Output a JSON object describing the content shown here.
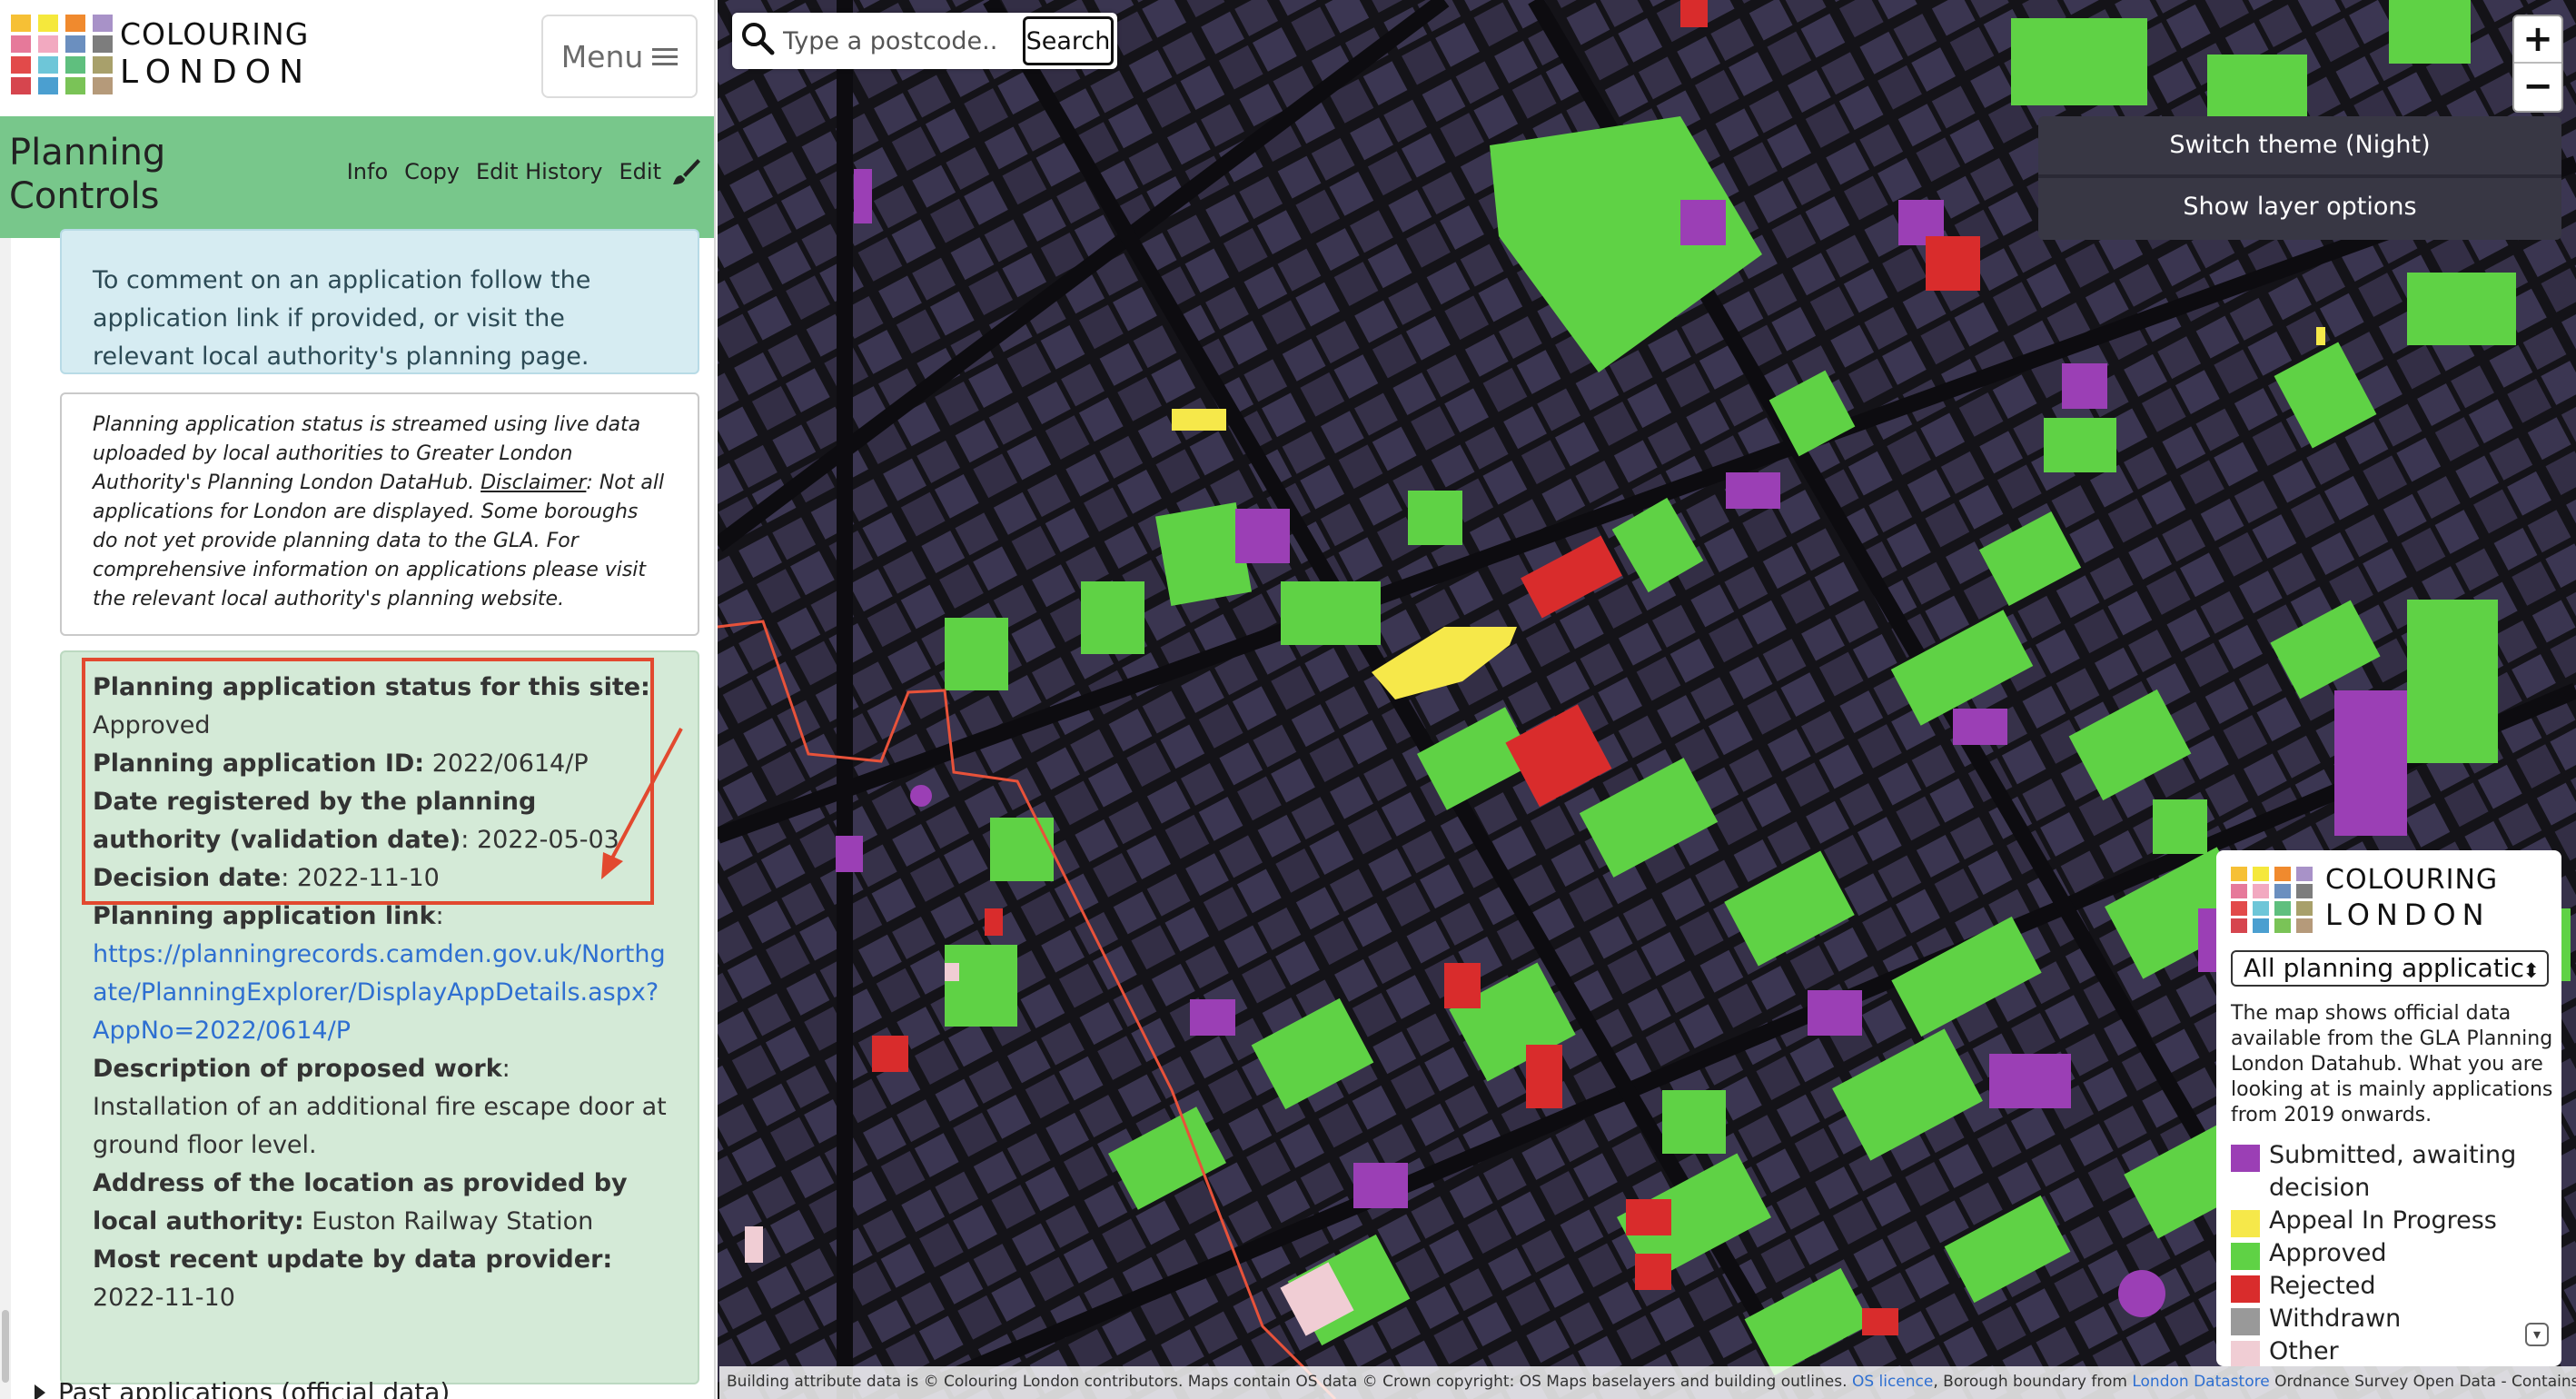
{
  "app": {
    "logo_line1": "COLOURING",
    "logo_line2": "LONDON",
    "menu_label": "Menu"
  },
  "section": {
    "title": "Planning Controls",
    "links": [
      "Info",
      "Copy",
      "Edit History",
      "Edit"
    ]
  },
  "info_panel": {
    "text": "To comment on an application follow the application link if provided, or visit the relevant local authority's planning page."
  },
  "disclaimer_panel": {
    "text1": "Planning application status is streamed using live data uploaded by local authorities to Greater London Authority's Planning London DataHub.",
    "disclaimer_label": "Disclaimer",
    "text2": ": Not all applications for London are displayed. Some boroughs do not yet provide planning data to the GLA. For comprehensive information on applications please visit the relevant local authority's planning website."
  },
  "status_panel": {
    "status_label": "Planning application status for this site:",
    "status_value": "Approved",
    "id_label": "Planning application ID:",
    "id_value": "2022/0614/P",
    "date_label": "Date registered by the planning authority (validation date)",
    "date_value": ": 2022-05-03",
    "decision_label": "Decision date",
    "decision_value": ": 2022-11-10",
    "link_label": "Planning application link",
    "link_colon": ":",
    "link_value": "https://planningrecords.camden.gov.uk/Northgate/PlanningExplorer/DisplayAppDetails.aspx?AppNo=2022/0614/P",
    "description_label": "Description of proposed work",
    "description_colon": ":",
    "description_value": "Installation of an additional fire escape door at ground floor level.",
    "address_label": "Address of the location as provided by local authority:",
    "address_value": "Euston Railway Station",
    "update_label": "Most recent update by data provider:",
    "update_value": "2022-11-10"
  },
  "past_apps": {
    "label": "Past applications (official data)"
  },
  "search": {
    "placeholder": "Type a postcode..",
    "button_label": "Search"
  },
  "zoom": {
    "in_label": "+",
    "out_label": "−"
  },
  "map_controls": {
    "theme_label": "Switch theme (Night)",
    "layer_label": "Show layer options"
  },
  "legend": {
    "logo_line1": "COLOURING",
    "logo_line2": "LONDON",
    "select_value": "All planning applicatic",
    "description": "The map shows official data available from the GLA Planning London Datahub. What you are looking at is mainly applications from 2019 onwards.",
    "items": [
      {
        "label": "Submitted, awaiting decision",
        "color": "#9b3fb5"
      },
      {
        "label": "Appeal In Progress",
        "color": "#f6e84a"
      },
      {
        "label": "Approved",
        "color": "#5fd245"
      },
      {
        "label": "Rejected",
        "color": "#d92c2c"
      },
      {
        "label": "Withdrawn",
        "color": "#999999"
      },
      {
        "label": "Other",
        "color": "#f0cdd4"
      }
    ]
  },
  "attribution": {
    "text1": "Building attribute data is © Colouring London contributors. Maps contain OS data © Crown copyright: OS Maps baselayers and building outlines. ",
    "os_licence": "OS licence",
    "text2": ", Borough boundary from ",
    "datastore": "London Datastore",
    "text3": " Ordnance Survey Open Data - Contains public"
  },
  "colors": {
    "section_header": "#78c78b",
    "map_background": "#2b2838",
    "approved": "#5fd245",
    "submitted": "#9b3fb5",
    "rejected": "#d92c2c",
    "appeal": "#f6e84a"
  }
}
